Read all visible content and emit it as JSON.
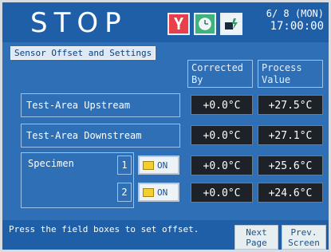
{
  "header": {
    "status": "STOP",
    "date": "6/ 8 (MON)",
    "time": "17:00:00"
  },
  "icons": {
    "alarm": "alarm-icon",
    "clock": "clock-icon",
    "network": "network-icon"
  },
  "section": {
    "title": "Sensor Offset and Settings"
  },
  "columns": {
    "corrected": "Corrected By",
    "process": "Process Value"
  },
  "rows": [
    {
      "label": "Test-Area Upstream",
      "corrected": "+0.0°C",
      "process": "+27.5°C"
    },
    {
      "label": "Test-Area Downstream",
      "corrected": "+0.0°C",
      "process": "+27.1°C"
    }
  ],
  "specimens": {
    "label": "Specimen",
    "items": [
      {
        "num": "1",
        "state": "ON",
        "corrected": "+0.0°C",
        "process": "+25.6°C"
      },
      {
        "num": "2",
        "state": "ON",
        "corrected": "+0.0°C",
        "process": "+24.6°C"
      }
    ]
  },
  "footer": {
    "hint": "Press the field boxes to set offset.",
    "next": "Next Page",
    "prev": "Prev. Screen"
  },
  "colors": {
    "background": "#2f6fb5",
    "header": "#1f5fa8",
    "alarm": "#e8404b",
    "clock": "#3fb37e",
    "indicator": "#f2cf2d"
  }
}
